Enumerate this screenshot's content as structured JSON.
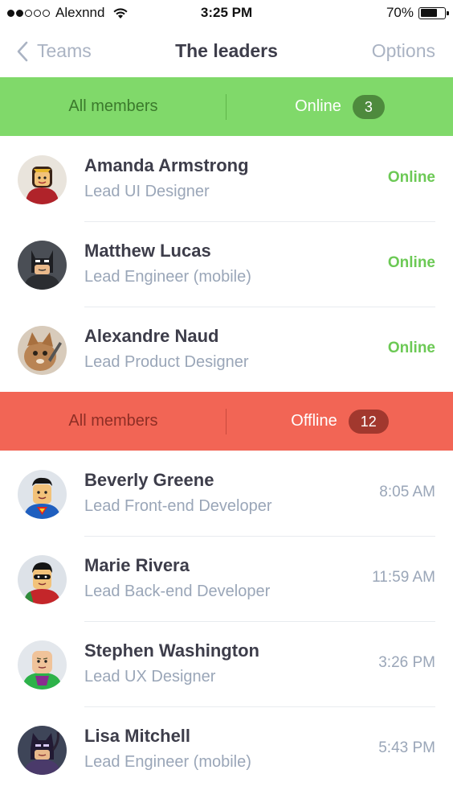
{
  "status_bar": {
    "carrier": "Alexnnd",
    "time": "3:25 PM",
    "battery": "70%",
    "battery_level": 0.7
  },
  "nav": {
    "back_label": "Teams",
    "title": "The leaders",
    "options_label": "Options"
  },
  "online_section": {
    "all_label": "All members",
    "active_label": "Online",
    "count": "3"
  },
  "online_members": [
    {
      "name": "Amanda Armstrong",
      "role": "Lead UI Designer",
      "status": "Online",
      "avatar_icon": "wonder-woman-avatar-icon"
    },
    {
      "name": "Matthew Lucas",
      "role": "Lead Engineer (mobile)",
      "status": "Online",
      "avatar_icon": "batman-avatar-icon"
    },
    {
      "name": "Alexandre Naud",
      "role": "Lead Product Designer",
      "status": "Online",
      "avatar_icon": "cat-avatar-icon"
    }
  ],
  "offline_section": {
    "all_label": "All members",
    "active_label": "Offline",
    "count": "12"
  },
  "offline_members": [
    {
      "name": "Beverly Greene",
      "role": "Lead Front-end Developer",
      "status": "8:05 AM",
      "avatar_icon": "superman-avatar-icon"
    },
    {
      "name": "Marie Rivera",
      "role": "Lead Back-end Developer",
      "status": "11:59 AM",
      "avatar_icon": "robin-avatar-icon"
    },
    {
      "name": "Stephen Washington",
      "role": "Lead UX Designer",
      "status": "3:26 PM",
      "avatar_icon": "lex-luthor-avatar-icon"
    },
    {
      "name": "Lisa Mitchell",
      "role": "Lead Engineer (mobile)",
      "status": "5:43 PM",
      "avatar_icon": "catwoman-avatar-icon"
    }
  ],
  "colors": {
    "online": "#80d96a",
    "offline": "#f26555",
    "online_text": "#6cc955",
    "muted": "#9aa6b8"
  }
}
